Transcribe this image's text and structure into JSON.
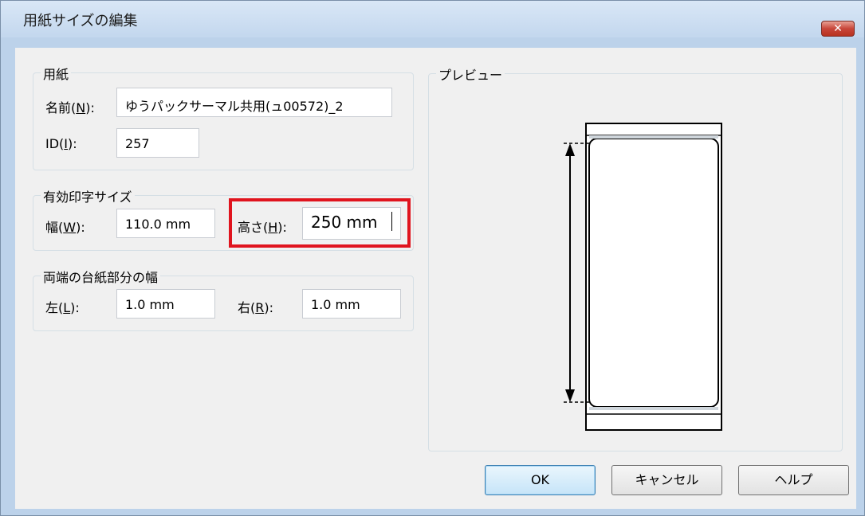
{
  "window": {
    "title": "用紙サイズの編集",
    "close_symbol": "✕"
  },
  "paper": {
    "group_label": "用紙",
    "name_label_prefix": "名前(",
    "name_label_key": "N",
    "name_label_suffix": "):",
    "name_value": "ゆうパックサーマル共用(ュ00572)_2",
    "id_label_prefix": "ID(",
    "id_label_key": "I",
    "id_label_suffix": "):",
    "id_value": "257"
  },
  "print_size": {
    "group_label": "有効印字サイズ",
    "width_label_prefix": "幅(",
    "width_label_key": "W",
    "width_label_suffix": "):",
    "width_value": "110.0 mm",
    "height_label_prefix": "高さ(",
    "height_label_key": "H",
    "height_label_suffix": "):",
    "height_value": "250 mm"
  },
  "margins": {
    "group_label": "両端の台紙部分の幅",
    "left_label_prefix": "左(",
    "left_label_key": "L",
    "left_label_suffix": "):",
    "left_value": "1.0 mm",
    "right_label_prefix": "右(",
    "right_label_key": "R",
    "right_label_suffix": "):",
    "right_value": "1.0 mm"
  },
  "preview": {
    "group_label": "プレビュー"
  },
  "buttons": {
    "ok": "OK",
    "cancel": "キャンセル",
    "help": "ヘルプ"
  },
  "colors": {
    "highlight": "#e0141e",
    "title_bg": "#c3d7ee",
    "client_bg": "#f0f0f0"
  }
}
